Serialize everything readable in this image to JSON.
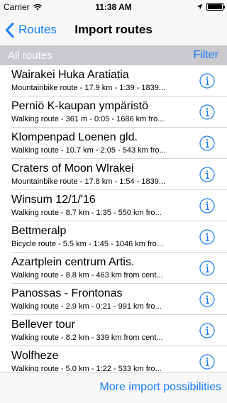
{
  "status_bar": {
    "carrier": "Carrier",
    "time": "11:38 AM",
    "icons": [
      "wifi-icon",
      "location-arrow-icon",
      "battery-icon"
    ]
  },
  "nav_bar": {
    "back_label": "Routes",
    "title": "Import routes"
  },
  "section": {
    "title": "All routes",
    "filter_label": "Filter"
  },
  "routes": [
    {
      "title": "Wairakei Huka Aratiatia",
      "subtitle": "Mountainbike route - 17.9 km - 1:39 - 1839..."
    },
    {
      "title": "Perniö K-kaupan ympäristö",
      "subtitle": "Walking route - 361 m - 0:05 - 1686 km fro..."
    },
    {
      "title": "Klompenpad Loenen gld.",
      "subtitle": "Walking route - 10.7 km - 2:05 - 543 km fro..."
    },
    {
      "title": "Craters of Moon Wlrakei",
      "subtitle": "Mountainbike route - 17.8 km - 1:54 - 1839..."
    },
    {
      "title": "Winsum 12/1/'16",
      "subtitle": "Walking route - 8.7 km - 1:35 - 550 km fro..."
    },
    {
      "title": "Bettmeralp",
      "subtitle": "Bicycle route - 5.5 km - 1:45 - 1046 km fro..."
    },
    {
      "title": "Azartplein centrum Artis.",
      "subtitle": "Walking route - 8.8 km - 463 km from cent..."
    },
    {
      "title": "Panossas - Frontonas",
      "subtitle": "Walking route - 2.9 km - 0:21 - 991 km fro..."
    },
    {
      "title": "Bellever tour",
      "subtitle": "Walking route - 8.2 km - 339 km from cent..."
    },
    {
      "title": "Wolfheze",
      "subtitle": "Walking route - 5.0 km - 1:22 - 533 km fro..."
    }
  ],
  "bottom_bar": {
    "more_label": "More import possibilities"
  },
  "colors": {
    "accent": "#1a7cf5",
    "section_header_bg": "#c9c9ce",
    "bar_bg": "#f7f7f7"
  }
}
